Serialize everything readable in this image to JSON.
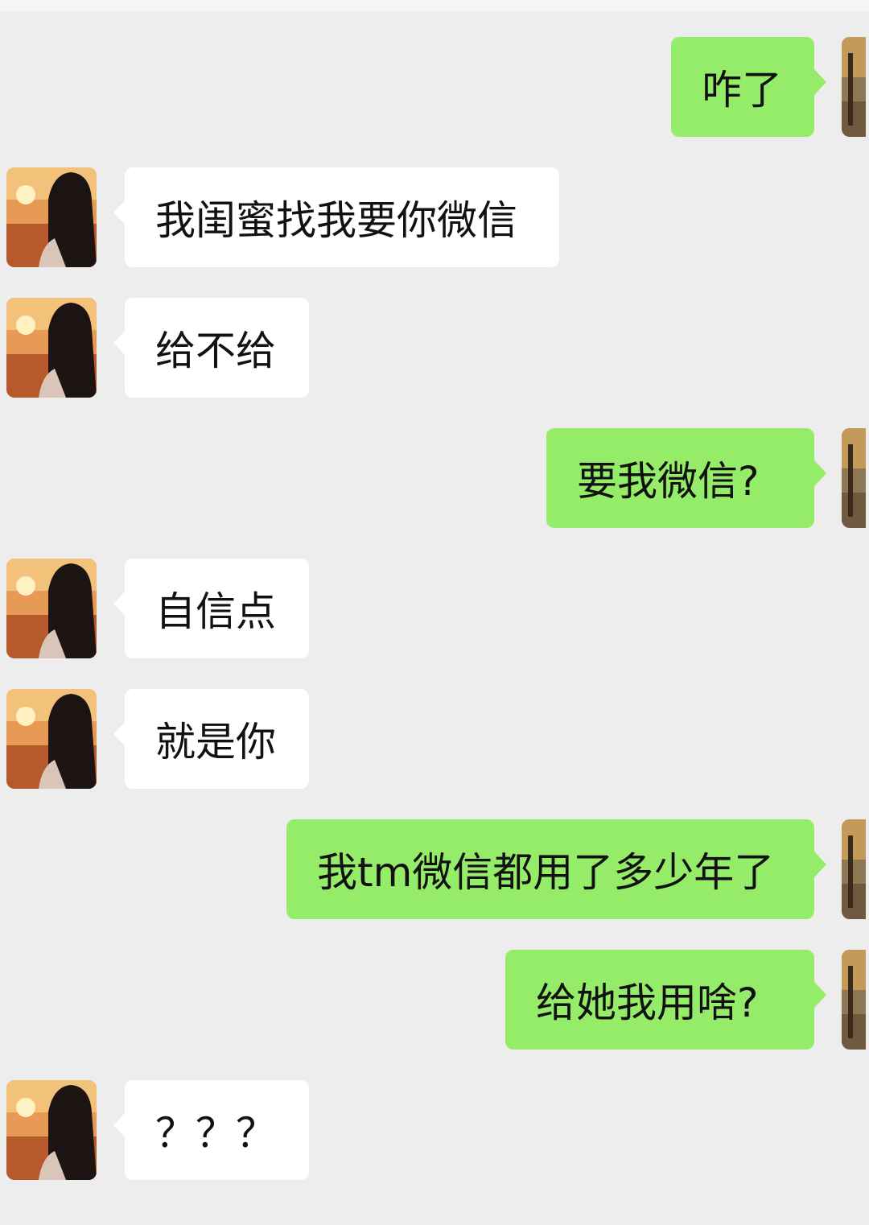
{
  "colors": {
    "background": "#ededed",
    "incoming_bubble": "#ffffff",
    "outgoing_bubble": "#95ec69",
    "text": "#111111"
  },
  "messages": [
    {
      "side": "right",
      "text": "咋了"
    },
    {
      "side": "left",
      "text": "我闺蜜找我要你微信"
    },
    {
      "side": "left",
      "text": "给不给"
    },
    {
      "side": "right",
      "text": "要我微信?"
    },
    {
      "side": "left",
      "text": "自信点"
    },
    {
      "side": "left",
      "text": "就是你"
    },
    {
      "side": "right",
      "text": "我tm微信都用了多少年了"
    },
    {
      "side": "right",
      "text": "给她我用啥?"
    },
    {
      "side": "left",
      "text": "？？？"
    }
  ]
}
